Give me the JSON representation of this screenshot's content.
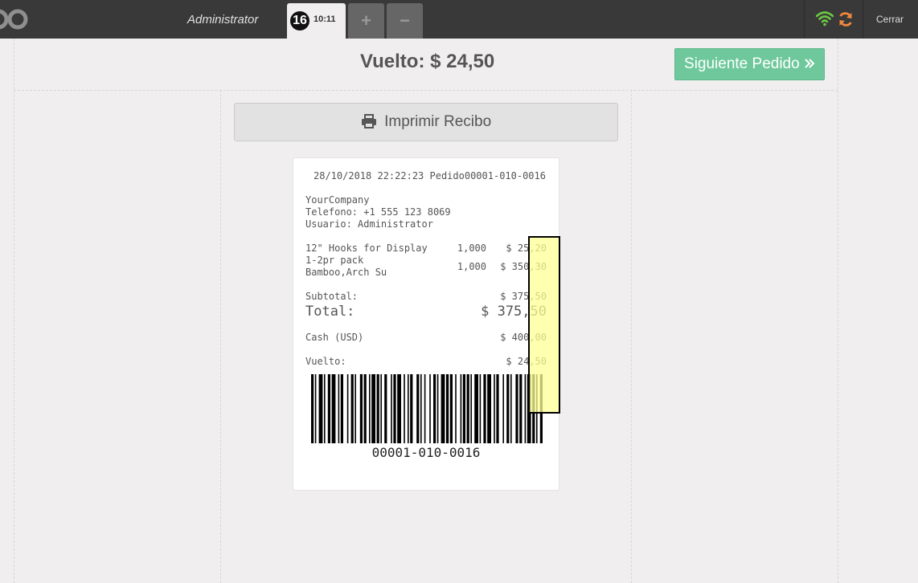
{
  "header": {
    "user": "Administrator",
    "order_number": "16",
    "order_time": "10:11",
    "add_order_symbol": "+",
    "remove_order_symbol": "−",
    "close_label": "Cerrar",
    "colors": {
      "bar": "#393939",
      "wifi": "#6cc644",
      "sync": "#f0883e"
    }
  },
  "screen": {
    "change_label": "Vuelto: $ 24,50",
    "next_order_label": "Siguiente Pedido",
    "print_label": "Imprimir Recibo",
    "accent": "#6ec89b"
  },
  "receipt": {
    "header_line": "28/10/2018 22:22:23 Pedido00001-010-0016",
    "company": "YourCompany",
    "phone": "Telefono: +1 555 123 8069",
    "user": "Usuario: Administrator",
    "lines": [
      {
        "name": "12\" Hooks for Display",
        "qty": "1,000",
        "price": "$ 25,20"
      },
      {
        "name": "1-2pr pack",
        "name2": "Bamboo,Arch Su",
        "qty": "1,000",
        "price": "$ 350,30"
      }
    ],
    "subtotal_label": "Subtotal:",
    "subtotal": "$ 375,50",
    "total_label": "Total:",
    "total": "$ 375,50",
    "payment_label": "Cash (USD)",
    "payment": "$ 400,00",
    "change_label": "Vuelto:",
    "change": "$ 24,50",
    "barcode": "00001-010-0016"
  }
}
